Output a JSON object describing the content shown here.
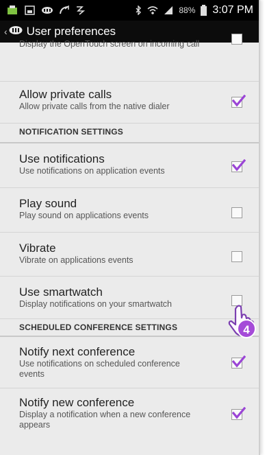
{
  "status_bar": {
    "battery_text": "88%",
    "time": "3:07 PM"
  },
  "action_bar": {
    "title": "User preferences"
  },
  "items": [
    {
      "title": "",
      "summary": "Display the OpenTouch screen on incoming call",
      "checked": false
    },
    {
      "title": "Allow private calls",
      "summary": "Allow private calls from the native dialer",
      "checked": true
    },
    {
      "title": "Use notifications",
      "summary": "Use notifications on application events",
      "checked": true
    },
    {
      "title": "Play sound",
      "summary": "Play sound on applications events",
      "checked": false
    },
    {
      "title": "Vibrate",
      "summary": "Vibrate on applications events",
      "checked": false
    },
    {
      "title": "Use smartwatch",
      "summary": "Display notifications on your smartwatch",
      "checked": false
    },
    {
      "title": "Notify next conference",
      "summary": "Use notifications on scheduled conference events",
      "checked": true
    },
    {
      "title": "Notify new conference",
      "summary": "Display a notification when a new conference appears",
      "checked": true
    }
  ],
  "sections": {
    "notification": "NOTIFICATION SETTINGS",
    "scheduled": "SCHEDULED CONFERENCE SETTINGS"
  },
  "gesture": {
    "step_number": "4"
  },
  "colors": {
    "checkmark": "#9b45d6",
    "hand_outline": "#7b3fb0",
    "badge": "#a54bd8"
  }
}
